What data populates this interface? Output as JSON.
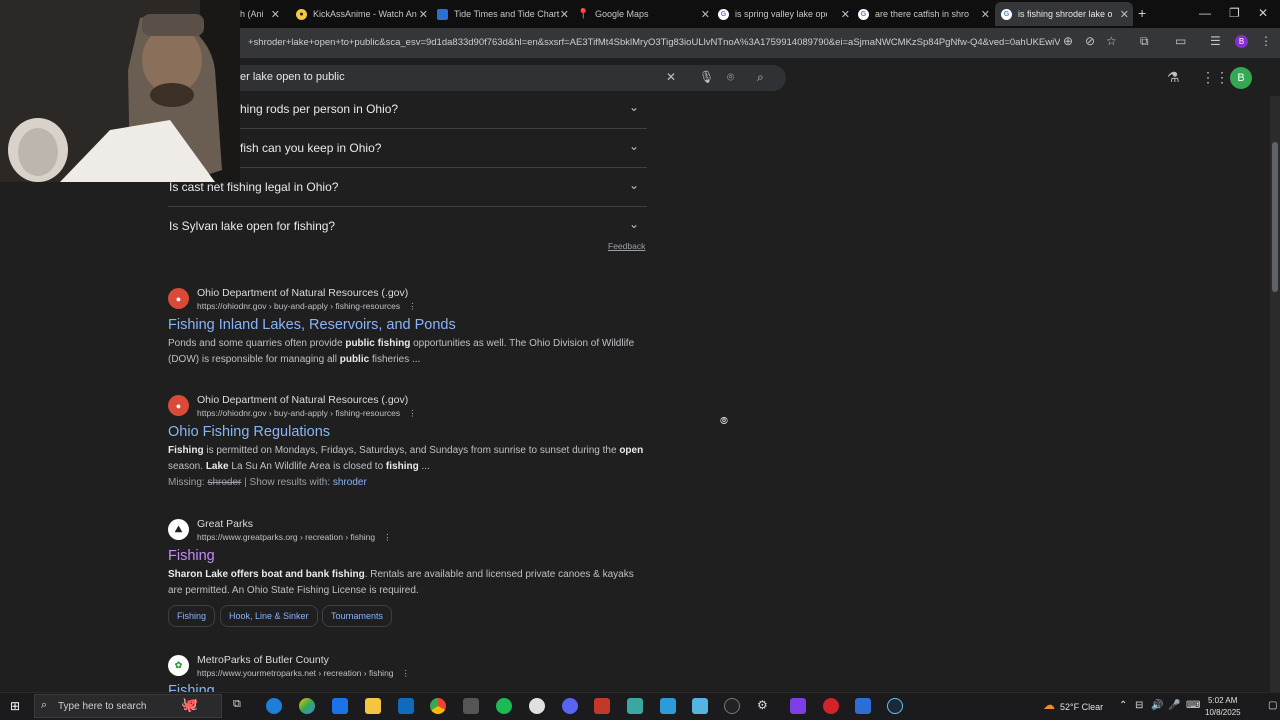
{
  "browser": {
    "tabs": [
      {
        "title": "h (Ani",
        "favicon": "#2d2d2d"
      },
      {
        "title": "KickAssAnime - Watch An",
        "favicon": "#f6c744"
      },
      {
        "title": "Tide Times and Tide Chart",
        "favicon": "#2b6fd6"
      },
      {
        "title": "Google Maps",
        "favicon": "#34a853"
      },
      {
        "title": "is spring valley lake open",
        "favicon": "#ffffff"
      },
      {
        "title": "are there catfish in shrod",
        "favicon": "#ffffff"
      },
      {
        "title": "is fishing shroder lake ope",
        "favicon": "#ffffff"
      }
    ],
    "new_tab": "+",
    "url": "+shroder+lake+open+to+public&sca_esv=9d1da833d90f763d&hl=en&sxsrf=AE3TifMt4SbklMryO3Tig83ioULlvNTnoA%3A1759914089790&ei=aSjmaNWCMKzSp84PgNfw-Q4&ved=0ahUKEwiV26...",
    "profile_letter": "B"
  },
  "search": {
    "query": "er lake open to public"
  },
  "paa": [
    {
      "q": "hing rods per person in Ohio?"
    },
    {
      "q": "fish can you keep in Ohio?"
    },
    {
      "q": "Is cast net fishing legal in Ohio?"
    },
    {
      "q": "Is Sylvan lake open for fishing?"
    }
  ],
  "feedback": "Feedback",
  "results": [
    {
      "site": "Ohio Department of Natural Resources (.gov)",
      "url": "https://ohiodnr.gov › buy-and-apply › fishing-resources",
      "title": "Fishing Inland Lakes, Reservoirs, and Ponds",
      "snippet_html": "Ponds and some quarries often provide <b>public fishing</b> opportunities as well. The Ohio Division of Wildlife (DOW) is responsible for managing all <b>public</b> fisheries ..."
    },
    {
      "site": "Ohio Department of Natural Resources (.gov)",
      "url": "https://ohiodnr.gov › buy-and-apply › fishing-resources",
      "title": "Ohio Fishing Regulations",
      "snippet_html": "<b>Fishing</b> is permitted on Mondays, Fridays, Saturdays, and Sundays from sunrise to sunset during the <b>open</b> season. <b>Lake</b> La Su An Wildlife Area is closed to <b>fishing</b> ...",
      "missing_label": "Missing:",
      "missing_term": "shroder",
      "show_label": "| Show results with:",
      "show_term": "shroder"
    },
    {
      "site": "Great Parks",
      "url": "https://www.greatparks.org › recreation › fishing",
      "title": "Fishing",
      "snippet_html": "<b>Sharon Lake offers boat and bank fishing</b>. Rentals are available and licensed private canoes &amp; kayaks are permitted. An Ohio State Fishing License is required.",
      "chips": [
        "Fishing",
        "Hook, Line & Sinker",
        "Tournaments"
      ]
    },
    {
      "site": "MetroParks of Butler County",
      "url": "https://www.yourmetroparks.net › recreation › fishing",
      "title": "Fishing"
    }
  ],
  "taskbar": {
    "search_placeholder": "Type here to search",
    "weather": "52°F  Clear",
    "time": "5:02 AM",
    "date": "10/8/2025"
  }
}
